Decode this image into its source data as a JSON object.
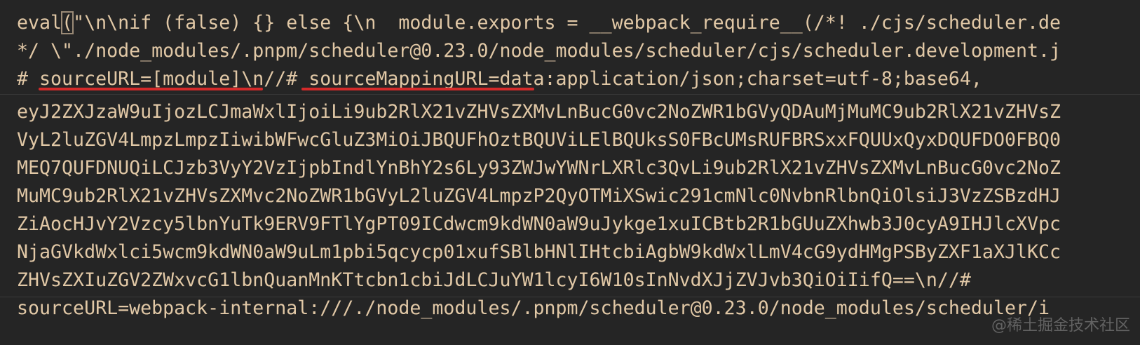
{
  "code": {
    "line1_pre": "eval",
    "line1_bracket": "(",
    "line1_post": "\"\\n\\nif (false) {} else {\\n  module.exports = __webpack_require__(/*! ./cjs/scheduler.de",
    "line2": "*/ \\\"./node_modules/.pnpm/scheduler@0.23.0/node_modules/scheduler/cjs/scheduler.development.j",
    "line3": "# sourceURL=[module]\\n//# sourceMappingURL=data:application/json;charset=utf-8;base64,",
    "line4": "eyJ2ZXJzaW9uIjozLCJmaWxlIjoiLi9ub2RlX21vZHVsZXMvLnBucG0vc2NoZWR1bGVyQDAuMjMuMC9ub2RlX21vZHVsZ",
    "line5": "VyL2luZGV4LmpzLmpzIiwibWFwcGluZ3MiOiJBQUFhOztBQUViLElBQUksS0FBcUMsRUFBRSxxFQUUxQyxDQUFDO0FBQ0",
    "line6": "MEQ7QUFDNUQiLCJzb3VyY2VzIjpbIndlYnBhY2s6Ly93ZWJwYWNrLXRlc3QvLi9ub2RlX21vZHVsZXMvLnBucG0vc2NoZ",
    "line7": "MuMC9ub2RlX21vZHVsZXMvc2NoZWR1bGVyL2luZGV4LmpzP2QyOTMiXSwic291cmNlc0NvbnRlbnQiOlsiJ3VzZSBzdHJ",
    "line8": "ZiAocHJvY2Vzcy5lbnYuTk9ERV9FTlYgPT09ICdwcm9kdWN0aW9uJykge1xuICBtb2R1bGUuZXhwb3J0cyA9IHJlcXVpc",
    "line9": "NjaGVkdWxlci5wcm9kdWN0aW9uLm1pbi5qcycp01xufSBlbHNlIHtcbiAgbW9kdWxlLmV4cG9ydHMgPSByZXF1aXJlKCc",
    "line10": "ZHVsZXIuZGV2ZWxvcG1lbnQuanMnKTtcbn1cbiJdLCJuYW1lcyI6W10sInNvdXJjZVJvb3QiOiIifQ==\\n//#",
    "line11": "sourceURL=webpack-internal:///./node_modules/.pnpm/scheduler@0.23.0/node_modules/scheduler/i"
  },
  "watermark": "@稀土掘金技术社区",
  "colors": {
    "background": "#252525",
    "text": "#e1c8a6",
    "annotation": "#d42a2a"
  }
}
